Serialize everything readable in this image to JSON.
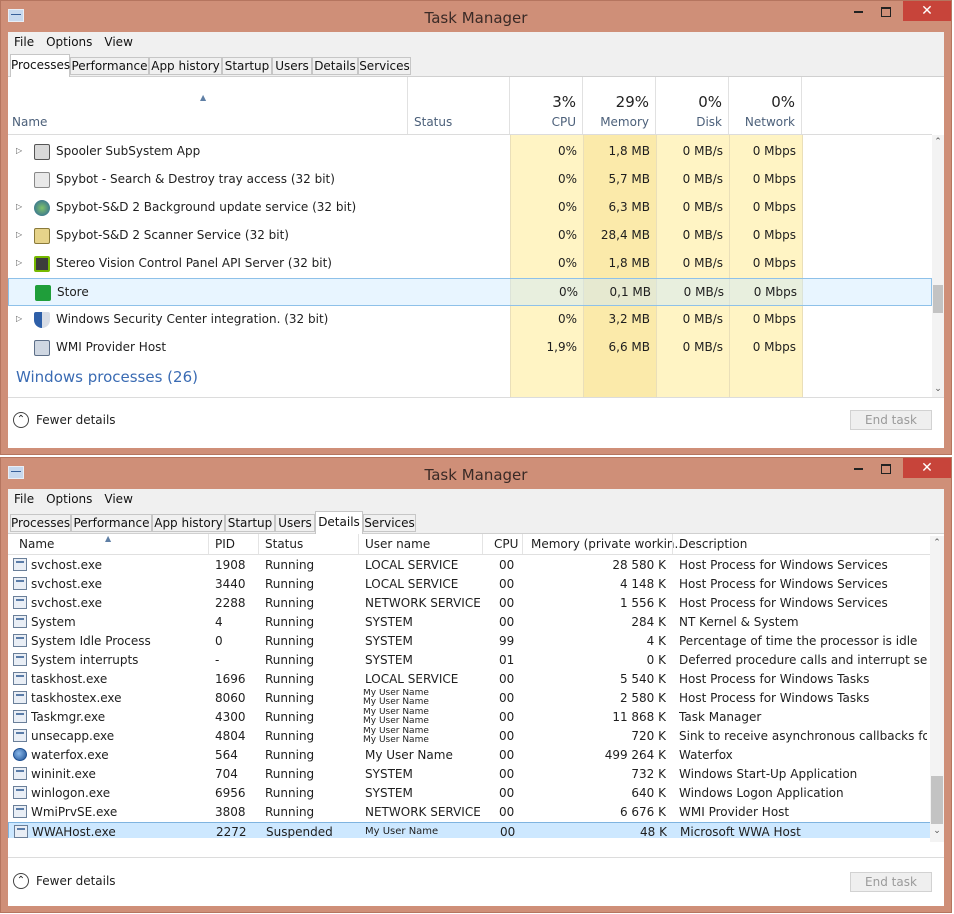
{
  "colors": {
    "frame": "#cf8f78",
    "close": "#c7443a",
    "highlight": "#fff4c4",
    "highlight_strong": "#fbe9a6",
    "selection": "#cde8ff",
    "group_heading": "#3a6bb3"
  },
  "window1": {
    "title": "Task Manager",
    "menu": [
      "File",
      "Options",
      "View"
    ],
    "tabs": [
      "Processes",
      "Performance",
      "App history",
      "Startup",
      "Users",
      "Details",
      "Services"
    ],
    "active_tab": "Processes",
    "header": {
      "name": "Name",
      "status": "Status",
      "cpu_pct": "3%",
      "cpu": "CPU",
      "memory_pct": "29%",
      "memory": "Memory",
      "disk_pct": "0%",
      "disk": "Disk",
      "network_pct": "0%",
      "network": "Network"
    },
    "rows": [
      {
        "name": "Spooler SubSystem App",
        "cpu": "0%",
        "memory": "1,8 MB",
        "disk": "0 MB/s",
        "network": "0 Mbps",
        "expand": true,
        "icon": "printer-icon"
      },
      {
        "name": "Spybot - Search & Destroy tray access (32 bit)",
        "cpu": "0%",
        "memory": "5,7 MB",
        "disk": "0 MB/s",
        "network": "0 Mbps",
        "expand": false,
        "icon": "spybot-icon"
      },
      {
        "name": "Spybot-S&D 2 Background update service (32 bit)",
        "cpu": "0%",
        "memory": "6,3 MB",
        "disk": "0 MB/s",
        "network": "0 Mbps",
        "expand": true,
        "icon": "update-globe-icon"
      },
      {
        "name": "Spybot-S&D 2 Scanner Service (32 bit)",
        "cpu": "0%",
        "memory": "28,4 MB",
        "disk": "0 MB/s",
        "network": "0 Mbps",
        "expand": true,
        "icon": "scanner-icon"
      },
      {
        "name": "Stereo Vision Control Panel API Server (32 bit)",
        "cpu": "0%",
        "memory": "1,8 MB",
        "disk": "0 MB/s",
        "network": "0 Mbps",
        "expand": true,
        "icon": "nvidia-icon"
      },
      {
        "name": "Store",
        "cpu": "0%",
        "memory": "0,1 MB",
        "disk": "0 MB/s",
        "network": "0 Mbps",
        "expand": false,
        "icon": "store-icon",
        "selected": true
      },
      {
        "name": "Windows Security Center integration. (32 bit)",
        "cpu": "0%",
        "memory": "3,2 MB",
        "disk": "0 MB/s",
        "network": "0 Mbps",
        "expand": true,
        "icon": "shield-icon"
      },
      {
        "name": "WMI Provider Host",
        "cpu": "1,9%",
        "memory": "6,6 MB",
        "disk": "0 MB/s",
        "network": "0 Mbps",
        "expand": false,
        "icon": "wmi-icon"
      }
    ],
    "group_heading": "Windows processes (26)",
    "fewer_details": "Fewer details",
    "end_task": "End task"
  },
  "window2": {
    "title": "Task Manager",
    "menu": [
      "File",
      "Options",
      "View"
    ],
    "tabs": [
      "Processes",
      "Performance",
      "App history",
      "Startup",
      "Users",
      "Details",
      "Services"
    ],
    "active_tab": "Details",
    "columns": [
      "Name",
      "PID",
      "Status",
      "User name",
      "CPU",
      "Memory (private workin...",
      "Description"
    ],
    "rows": [
      {
        "name": "svchost.exe",
        "pid": "1908",
        "status": "Running",
        "user": "LOCAL SERVICE",
        "cpu": "00",
        "memory": "28 580 K",
        "description": "Host Process for Windows Services",
        "icon": "app-window-icon"
      },
      {
        "name": "svchost.exe",
        "pid": "3440",
        "status": "Running",
        "user": "LOCAL SERVICE",
        "cpu": "00",
        "memory": "4 148 K",
        "description": "Host Process for Windows Services",
        "icon": "app-window-icon"
      },
      {
        "name": "svchost.exe",
        "pid": "2288",
        "status": "Running",
        "user": "NETWORK SERVICE",
        "cpu": "00",
        "memory": "1 556 K",
        "description": "Host Process for Windows Services",
        "icon": "app-window-icon"
      },
      {
        "name": "System",
        "pid": "4",
        "status": "Running",
        "user": "SYSTEM",
        "cpu": "00",
        "memory": "284 K",
        "description": "NT Kernel & System",
        "icon": "app-window-icon"
      },
      {
        "name": "System Idle Process",
        "pid": "0",
        "status": "Running",
        "user": "SYSTEM",
        "cpu": "99",
        "memory": "4 K",
        "description": "Percentage of time the processor is idle",
        "icon": "app-window-icon"
      },
      {
        "name": "System interrupts",
        "pid": "-",
        "status": "Running",
        "user": "SYSTEM",
        "cpu": "01",
        "memory": "0 K",
        "description": "Deferred procedure calls and interrupt servic...",
        "icon": "app-window-icon"
      },
      {
        "name": "taskhost.exe",
        "pid": "1696",
        "status": "Running",
        "user": "LOCAL SERVICE",
        "cpu": "00",
        "memory": "5 540 K",
        "description": "Host Process for Windows Tasks",
        "icon": "app-window-icon"
      },
      {
        "name": "taskhostex.exe",
        "pid": "8060",
        "status": "Running",
        "user": "My User Name",
        "cpu": "00",
        "memory": "2 580 K",
        "description": "Host Process for Windows Tasks",
        "icon": "app-window-icon",
        "small_user": true
      },
      {
        "name": "Taskmgr.exe",
        "pid": "4300",
        "status": "Running",
        "user": "My User Name",
        "cpu": "00",
        "memory": "11 868 K",
        "description": "Task Manager",
        "icon": "task-manager-icon",
        "small_user": true
      },
      {
        "name": "unsecapp.exe",
        "pid": "4804",
        "status": "Running",
        "user": "My User Name",
        "cpu": "00",
        "memory": "720 K",
        "description": "Sink to receive asynchronous callbacks for W...",
        "icon": "app-window-icon",
        "small_user": true
      },
      {
        "name": "waterfox.exe",
        "pid": "564",
        "status": "Running",
        "user": "My User Name",
        "cpu": "00",
        "memory": "499 264 K",
        "description": "Waterfox",
        "icon": "globe-icon"
      },
      {
        "name": "wininit.exe",
        "pid": "704",
        "status": "Running",
        "user": "SYSTEM",
        "cpu": "00",
        "memory": "732 K",
        "description": "Windows Start-Up Application",
        "icon": "app-window-icon"
      },
      {
        "name": "winlogon.exe",
        "pid": "6956",
        "status": "Running",
        "user": "SYSTEM",
        "cpu": "00",
        "memory": "640 K",
        "description": "Windows Logon Application",
        "icon": "app-window-icon"
      },
      {
        "name": "WmiPrvSE.exe",
        "pid": "3808",
        "status": "Running",
        "user": "NETWORK SERVICE",
        "cpu": "00",
        "memory": "6 676 K",
        "description": "WMI Provider Host",
        "icon": "wmi-icon"
      },
      {
        "name": "WWAHost.exe",
        "pid": "2272",
        "status": "Suspended",
        "user": "My User Name",
        "cpu": "00",
        "memory": "48 K",
        "description": "Microsoft WWA Host",
        "icon": "app-window-icon",
        "selected": true
      }
    ],
    "fewer_details": "Fewer details",
    "end_task": "End task"
  }
}
